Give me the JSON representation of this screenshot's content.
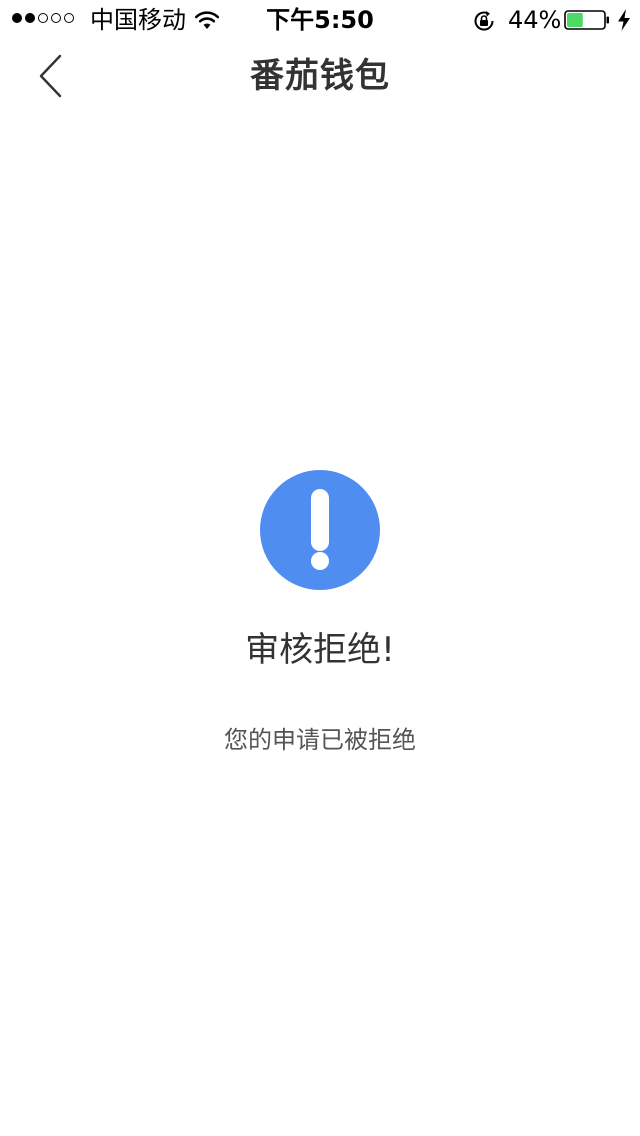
{
  "status_bar": {
    "carrier": "中国移动",
    "time": "下午5:50",
    "battery_percent": "44%",
    "signal_bars_filled": 2,
    "signal_bars_total": 5,
    "battery_level": 0.44,
    "battery_color": "#4cd964",
    "icons": [
      "wifi-icon",
      "rotation-lock-icon",
      "battery-icon",
      "charging-bolt-icon"
    ]
  },
  "nav": {
    "title": "番茄钱包",
    "back_icon": "chevron-left-icon"
  },
  "result": {
    "icon": "exclamation-circle-icon",
    "icon_color": "#4f8ef0",
    "title": "审核拒绝!",
    "description": "您的申请已被拒绝"
  }
}
